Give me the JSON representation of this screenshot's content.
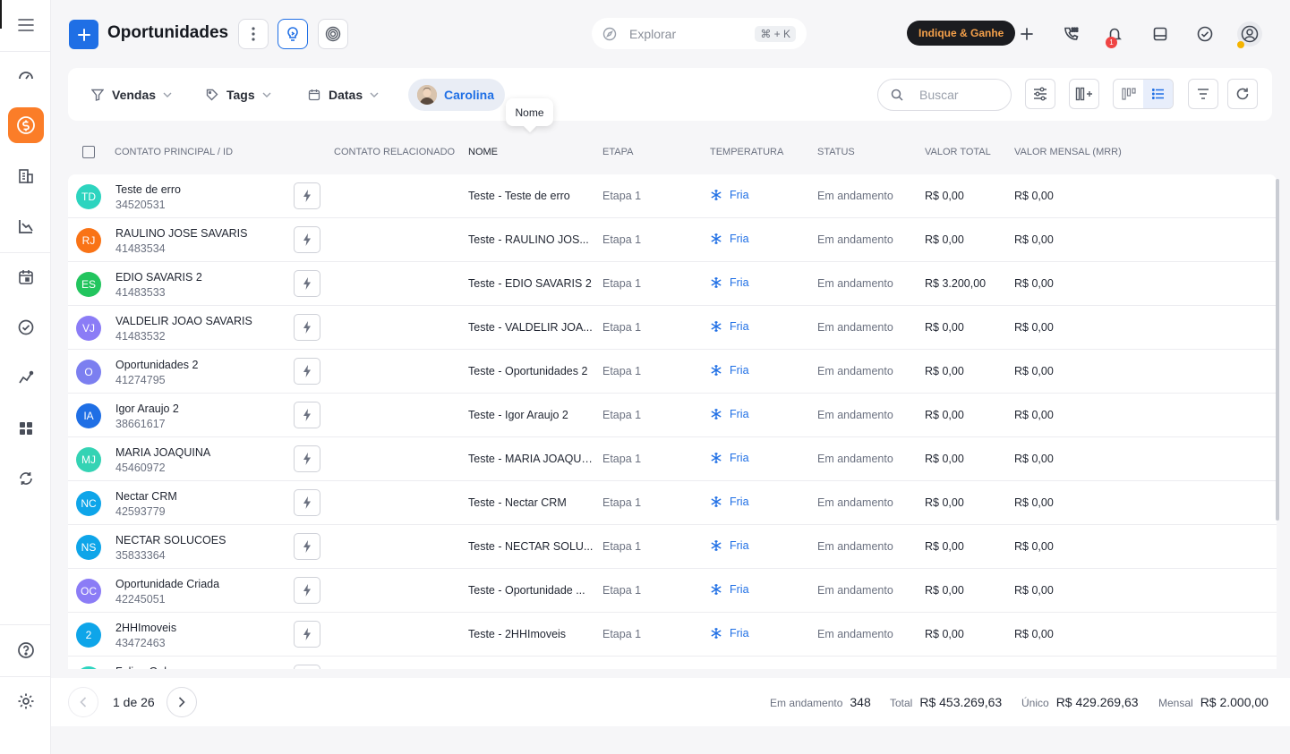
{
  "header": {
    "title": "Oportunidades",
    "explore_placeholder": "Explorar",
    "explore_shortcut": "⌘ + K",
    "refer_label": "Indique & Ganhe",
    "notification_count": "1"
  },
  "filters": {
    "vendas": "Vendas",
    "tags": "Tags",
    "datas": "Datas",
    "user": "Carolina",
    "search_placeholder": "Buscar"
  },
  "tooltip": "Nome",
  "columns": {
    "contato": "CONTATO PRINCIPAL / ID",
    "relacionado": "CONTATO RELACIONADO",
    "nome": "NOME",
    "etapa": "ETAPA",
    "temperatura": "TEMPERATURA",
    "status": "STATUS",
    "valor_total": "VALOR TOTAL",
    "valor_mensal": "VALOR MENSAL (MRR)"
  },
  "rows": [
    {
      "initials": "TD",
      "color": "#2dd4bf",
      "contact": "Teste de erro",
      "id": "34520531",
      "nome": "Teste - Teste de erro",
      "etapa": "Etapa 1",
      "temp": "Fria",
      "status": "Em andamento",
      "total": "R$ 0,00",
      "mrr": "R$ 0,00"
    },
    {
      "initials": "RJ",
      "color": "#f97316",
      "contact": "RAULINO JOSE SAVARIS",
      "id": "41483534",
      "nome": "Teste - RAULINO JOS...",
      "etapa": "Etapa 1",
      "temp": "Fria",
      "status": "Em andamento",
      "total": "R$ 0,00",
      "mrr": "R$ 0,00"
    },
    {
      "initials": "ES",
      "color": "#22c55e",
      "contact": "EDIO SAVARIS 2",
      "id": "41483533",
      "nome": "Teste - EDIO SAVARIS 2",
      "etapa": "Etapa 1",
      "temp": "Fria",
      "status": "Em andamento",
      "total": "R$ 3.200,00",
      "mrr": "R$ 0,00"
    },
    {
      "initials": "VJ",
      "color": "#8b7cf6",
      "contact": "VALDELIR JOAO SAVARIS",
      "id": "41483532",
      "nome": "Teste - VALDELIR JOA...",
      "etapa": "Etapa 1",
      "temp": "Fria",
      "status": "Em andamento",
      "total": "R$ 0,00",
      "mrr": "R$ 0,00"
    },
    {
      "initials": "O",
      "color": "#7c7ff0",
      "contact": "Oportunidades 2",
      "id": "41274795",
      "nome": "Teste - Oportunidades 2",
      "etapa": "Etapa 1",
      "temp": "Fria",
      "status": "Em andamento",
      "total": "R$ 0,00",
      "mrr": "R$ 0,00"
    },
    {
      "initials": "IA",
      "color": "#1f6fe5",
      "contact": "Igor Araujo 2",
      "id": "38661617",
      "nome": "Teste - Igor Araujo 2",
      "etapa": "Etapa 1",
      "temp": "Fria",
      "status": "Em andamento",
      "total": "R$ 0,00",
      "mrr": "R$ 0,00"
    },
    {
      "initials": "MJ",
      "color": "#34d3b4",
      "contact": "MARIA JOAQUINA",
      "id": "45460972",
      "nome": "Teste - MARIA JOAQUI...",
      "etapa": "Etapa 1",
      "temp": "Fria",
      "status": "Em andamento",
      "total": "R$ 0,00",
      "mrr": "R$ 0,00"
    },
    {
      "initials": "NC",
      "color": "#0ea5e9",
      "contact": "Nectar CRM",
      "id": "42593779",
      "nome": "Teste - Nectar CRM",
      "etapa": "Etapa 1",
      "temp": "Fria",
      "status": "Em andamento",
      "total": "R$ 0,00",
      "mrr": "R$ 0,00"
    },
    {
      "initials": "NS",
      "color": "#0ea5e9",
      "contact": "NECTAR SOLUCOES",
      "id": "35833364",
      "nome": "Teste - NECTAR SOLU...",
      "etapa": "Etapa 1",
      "temp": "Fria",
      "status": "Em andamento",
      "total": "R$ 0,00",
      "mrr": "R$ 0,00"
    },
    {
      "initials": "OC",
      "color": "#8b7cf6",
      "contact": "Oportunidade Criada",
      "id": "42245051",
      "nome": "Teste - Oportunidade ...",
      "etapa": "Etapa 1",
      "temp": "Fria",
      "status": "Em andamento",
      "total": "R$ 0,00",
      "mrr": "R$ 0,00"
    },
    {
      "initials": "2",
      "color": "#0ea5e9",
      "contact": "2HHImoveis",
      "id": "43472463",
      "nome": "Teste - 2HHImoveis",
      "etapa": "Etapa 1",
      "temp": "Fria",
      "status": "Em andamento",
      "total": "R$ 0,00",
      "mrr": "R$ 0,00"
    },
    {
      "initials": "",
      "color": "#2dd4bf",
      "contact": "Felipe Gabr...",
      "id": "",
      "nome": "",
      "etapa": "",
      "temp": "",
      "status": "",
      "total": "",
      "mrr": ""
    }
  ],
  "pagination": {
    "label": "1 de 26"
  },
  "totals": {
    "andamento_label": "Em andamento",
    "andamento_value": "348",
    "total_label": "Total",
    "total_value": "R$ 453.269,63",
    "unico_label": "Único",
    "unico_value": "R$ 429.269,63",
    "mensal_label": "Mensal",
    "mensal_value": "R$ 2.000,00"
  },
  "icons": {
    "sidebar": [
      "menu-icon",
      "dashboard-icon",
      "dollar-icon",
      "building-icon",
      "chart-icon",
      "calendar-icon",
      "check-circle-icon",
      "analytics-icon",
      "widgets-icon",
      "sync-icon",
      "help-icon",
      "settings-icon"
    ]
  }
}
